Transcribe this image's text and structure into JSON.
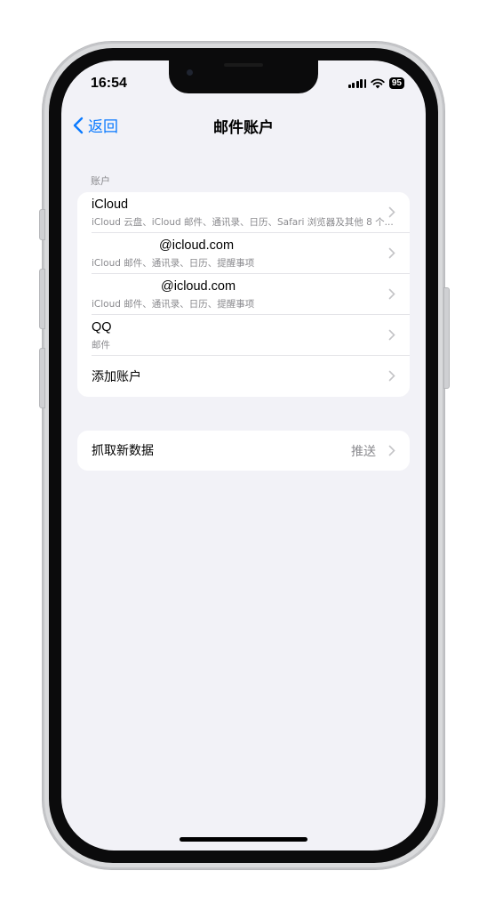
{
  "status_bar": {
    "time": "16:54",
    "battery": "95"
  },
  "nav": {
    "back_label": "返回",
    "title": "邮件账户"
  },
  "accounts_section": {
    "header": "账户",
    "rows": [
      {
        "title": "iCloud",
        "subtitle": "iCloud 云盘、iCloud 邮件、通讯录、日历、Safari 浏览器及其他 8 个..."
      },
      {
        "title": "@icloud.com",
        "subtitle": "iCloud 邮件、通讯录、日历、提醒事项"
      },
      {
        "title": "@icloud.com",
        "subtitle": "iCloud 邮件、通讯录、日历、提醒事项"
      },
      {
        "title": "QQ",
        "subtitle": "邮件"
      },
      {
        "title": "添加账户"
      }
    ]
  },
  "fetch_section": {
    "label": "抓取新数据",
    "value": "推送"
  },
  "colors": {
    "accent": "#0a7aff",
    "background": "#f2f2f7",
    "secondary_text": "#8a8a8e"
  }
}
